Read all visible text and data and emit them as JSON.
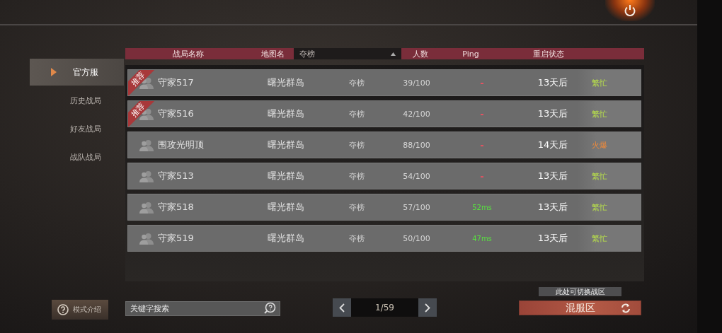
{
  "sidebar": {
    "items": [
      {
        "label": "官方服",
        "selected": true
      },
      {
        "label": "历史战局",
        "selected": false
      },
      {
        "label": "好友战局",
        "selected": false
      },
      {
        "label": "战队战局",
        "selected": false
      }
    ]
  },
  "table": {
    "columns": [
      "战局名称",
      "地图名",
      "人数",
      "Ping",
      "重启状态"
    ],
    "mode_filter": "夺榜",
    "rows": [
      {
        "badge": "推荐",
        "name": "守家517",
        "map": "曙光群岛",
        "mode": "夺榜",
        "players": "39/100",
        "ping": {
          "text": "-",
          "kind": "none"
        },
        "restart": "13天后",
        "status": {
          "text": "繁忙",
          "kind": "busy"
        }
      },
      {
        "badge": "推荐",
        "name": "守家516",
        "map": "曙光群岛",
        "mode": "夺榜",
        "players": "42/100",
        "ping": {
          "text": "-",
          "kind": "none"
        },
        "restart": "13天后",
        "status": {
          "text": "繁忙",
          "kind": "busy"
        }
      },
      {
        "name": "围攻光明顶",
        "map": "曙光群岛",
        "mode": "夺榜",
        "players": "88/100",
        "ping": {
          "text": "-",
          "kind": "none"
        },
        "restart": "14天后",
        "status": {
          "text": "火爆",
          "kind": "hot"
        }
      },
      {
        "name": "守家513",
        "map": "曙光群岛",
        "mode": "夺榜",
        "players": "54/100",
        "ping": {
          "text": "-",
          "kind": "none"
        },
        "restart": "13天后",
        "status": {
          "text": "繁忙",
          "kind": "busy"
        }
      },
      {
        "name": "守家518",
        "map": "曙光群岛",
        "mode": "夺榜",
        "players": "57/100",
        "ping": {
          "text": "52ms",
          "kind": "good"
        },
        "restart": "13天后",
        "status": {
          "text": "繁忙",
          "kind": "busy"
        }
      },
      {
        "name": "守家519",
        "map": "曙光群岛",
        "mode": "夺榜",
        "players": "50/100",
        "ping": {
          "text": "47ms",
          "kind": "good"
        },
        "restart": "13天后",
        "status": {
          "text": "繁忙",
          "kind": "busy"
        }
      }
    ]
  },
  "mode_intro_button": "模式介绍",
  "search": {
    "placeholder": "关键字搜索"
  },
  "pager": {
    "page": "1/59"
  },
  "server_switch": {
    "tooltip": "此处可切换战区",
    "label": "混服区"
  }
}
